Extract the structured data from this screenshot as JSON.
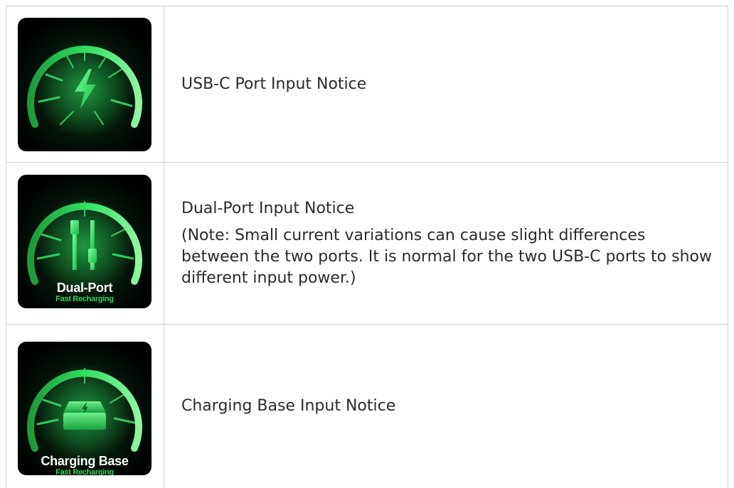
{
  "rows": [
    {
      "icon": "lightning-speedometer-icon",
      "title": "USB-C Port Input Notice"
    },
    {
      "icon": "dual-cable-speedometer-icon",
      "badge_title": "Dual-Port",
      "badge_subtitle": "Fast Recharging",
      "title": "Dual-Port Input Notice",
      "note": "(Note: Small current variations can cause slight differences between the two ports. It is normal for the two USB-C ports to show different input power.)"
    },
    {
      "icon": "charging-base-speedometer-icon",
      "badge_title": "Charging Base",
      "badge_subtitle": "Fast Recharging",
      "title": "Charging Base Input Notice"
    }
  ],
  "colors": {
    "accent_green": "#33d65c",
    "tile_background": "#000000",
    "border": "#cfcfcf"
  }
}
